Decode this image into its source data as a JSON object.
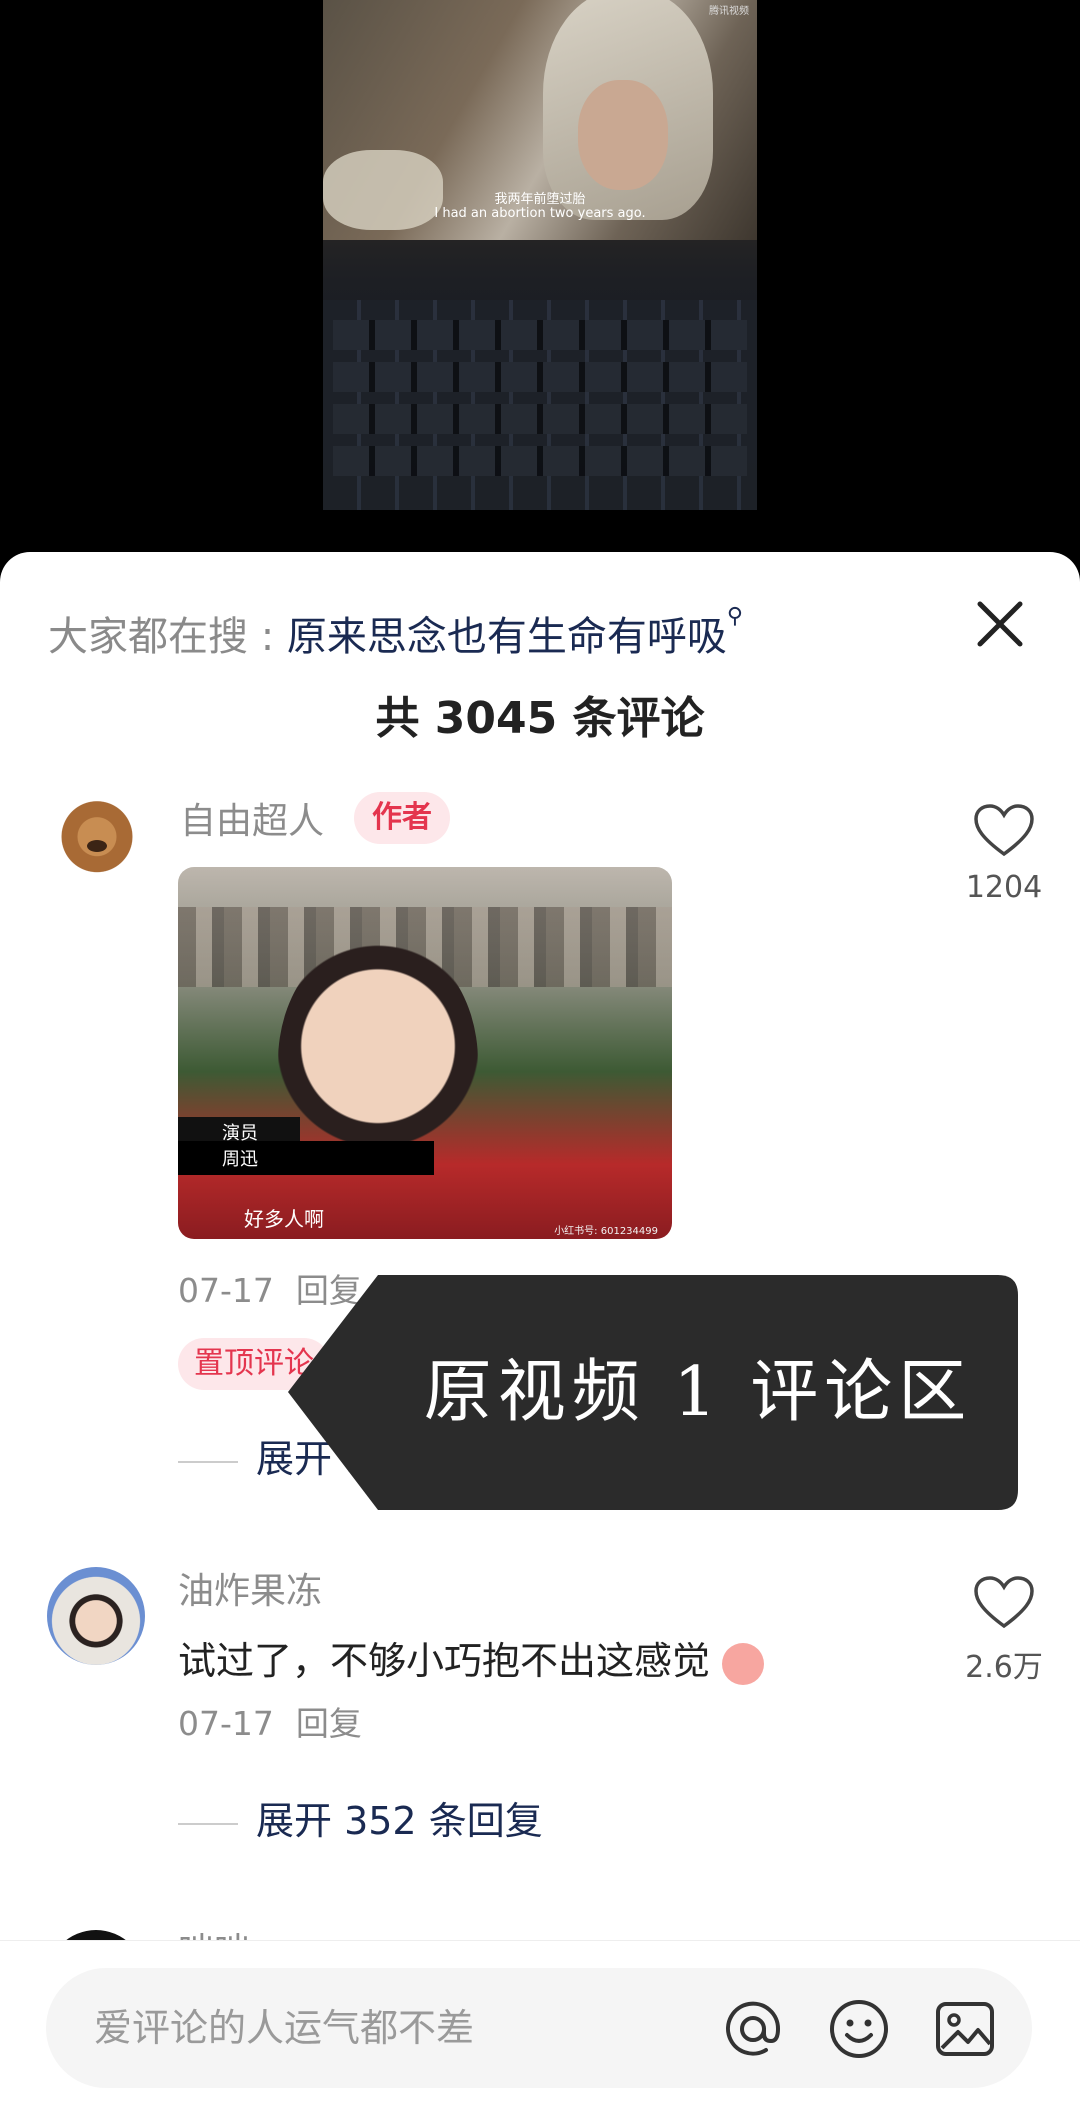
{
  "video": {
    "subtitle_cn": "我两年前堕过胎",
    "subtitle_en": "I had an abortion two years ago.",
    "watermark": "腾讯视频"
  },
  "comments_panel": {
    "hot_search_label": "大家都在搜 : ",
    "hot_search_query": "原来思念也有生命有呼吸",
    "total_count_text": "共 3045 条评论",
    "comments": [
      {
        "username": "自由超人",
        "author_tag": "作者",
        "image_caption_role": "演员",
        "image_caption_name": "周迅",
        "image_caption_line": "好多人啊",
        "image_watermark": "小红书号: 601234499",
        "date": "07-17",
        "reply_label": "回复",
        "pinned_label": "置顶评论",
        "likes": "1204",
        "expand_text": "展开 12 条回复"
      },
      {
        "username": "油炸果冻",
        "text": "试过了，不够小巧抱不出这感觉",
        "date": "07-17",
        "reply_label": "回复",
        "likes": "2.6万",
        "expand_text": "展开 352 条回复"
      },
      {
        "username": "咄咄"
      }
    ]
  },
  "overlay_label": "原视频 1 评论区",
  "input": {
    "placeholder": "爱评论的人运气都不差",
    "icons": [
      "at-icon",
      "emoji-icon",
      "image-icon"
    ]
  },
  "colors": {
    "accent_red": "#e4354e",
    "link_navy": "#1a2a52",
    "overlay_bg": "#2b2b2b"
  }
}
